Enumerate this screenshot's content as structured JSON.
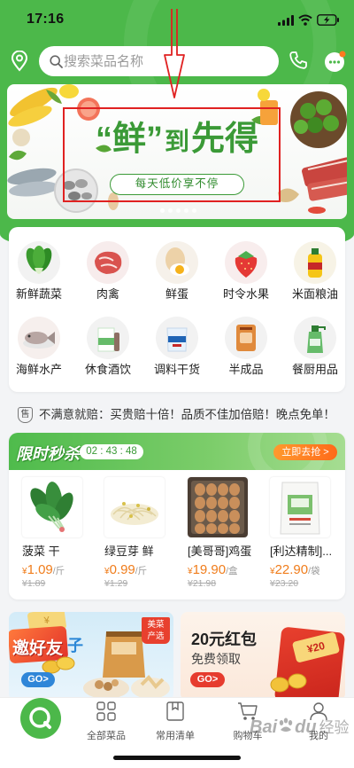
{
  "status_bar": {
    "time": "17:16",
    "icons": [
      "signal-icon",
      "wifi-icon",
      "battery-charging-icon"
    ]
  },
  "header": {
    "search_placeholder": "搜索菜品名称",
    "icons": [
      "location-pin-icon",
      "search-icon",
      "phone-icon",
      "message-icon"
    ]
  },
  "banner": {
    "title_main": "“鲜”",
    "title_small": "到",
    "title_end": "先得",
    "subtitle": "每天低价享不停"
  },
  "categories": [
    {
      "label": "新鲜蔬菜",
      "icon": "vegetable-icon"
    },
    {
      "label": "肉禽",
      "icon": "meat-icon"
    },
    {
      "label": "鲜蛋",
      "icon": "egg-icon"
    },
    {
      "label": "时令水果",
      "icon": "strawberry-icon"
    },
    {
      "label": "米面粮油",
      "icon": "oil-bottle-icon"
    },
    {
      "label": "海鲜水产",
      "icon": "fish-icon"
    },
    {
      "label": "休食酒饮",
      "icon": "drink-box-icon"
    },
    {
      "label": "调料干货",
      "icon": "seasoning-bag-icon"
    },
    {
      "label": "半成品",
      "icon": "packaged-food-icon"
    },
    {
      "label": "餐厨用品",
      "icon": "detergent-bottle-icon"
    }
  ],
  "guarantee": {
    "badge": "售",
    "text": "不满意就赔：买贵赔十倍！品质不佳加倍赔！晚点免单！"
  },
  "flash_sale": {
    "title": "限时秒杀",
    "countdown": "02 : 43 : 48",
    "button": "立即去抢 >",
    "products": [
      {
        "name": "菠菜 干",
        "currency": "¥",
        "price": "1.09",
        "unit": "/斤",
        "old_price": "¥1.89",
        "image": "spinach-image"
      },
      {
        "name": "绿豆芽 鲜",
        "currency": "¥",
        "price": "0.99",
        "unit": "/斤",
        "old_price": "¥1.29",
        "image": "bean-sprouts-image"
      },
      {
        "name": "[美哥哥]鸡蛋",
        "currency": "¥",
        "price": "19.90",
        "unit": "/盒",
        "old_price": "¥21.98",
        "image": "egg-box-image"
      },
      {
        "name": "[利达精制]...",
        "currency": "¥",
        "price": "22.90",
        "unit": "/袋",
        "old_price": "¥23.20",
        "image": "flour-bag-image"
      }
    ]
  },
  "promos": {
    "invite": {
      "coin_card": "¥",
      "title": "邀好友",
      "partial_text": "子",
      "badge_line1": "美菜",
      "badge_line2": "产选",
      "go": "GO>"
    },
    "red_packet": {
      "title": "20元红包",
      "subtitle": "免费领取",
      "coupon": "¥20",
      "go": "GO>"
    }
  },
  "tabbar": {
    "items": [
      {
        "label": "",
        "icon": "home-logo-icon"
      },
      {
        "label": "全部菜品",
        "icon": "grid-icon"
      },
      {
        "label": "常用清单",
        "icon": "list-bookmark-icon"
      },
      {
        "label": "购物车",
        "icon": "cart-icon"
      },
      {
        "label": "我的",
        "icon": "user-icon"
      }
    ]
  },
  "watermark": {
    "part1": "Bai",
    "part2": "du",
    "part3": "经验"
  },
  "colors": {
    "brand_green": "#4cb84a",
    "price_orange": "#f07d1c",
    "cta_orange": "#ff7a1f",
    "annotation_red": "#e02121"
  }
}
